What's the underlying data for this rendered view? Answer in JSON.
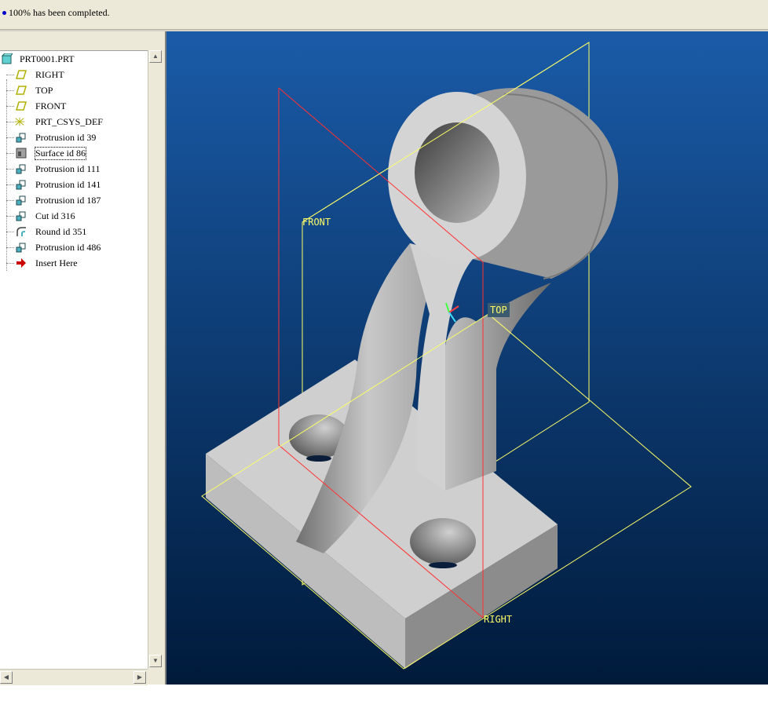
{
  "message_bar": {
    "text": "100% has been completed."
  },
  "model_tree": {
    "root": "PRT0001.PRT",
    "items": [
      {
        "label": "RIGHT",
        "icon": "datum-plane-icon"
      },
      {
        "label": "TOP",
        "icon": "datum-plane-icon"
      },
      {
        "label": "FRONT",
        "icon": "datum-plane-icon"
      },
      {
        "label": "PRT_CSYS_DEF",
        "icon": "coordinate-system-icon"
      },
      {
        "label": "Protrusion id 39",
        "icon": "protrusion-icon"
      },
      {
        "label": "Surface id 86",
        "icon": "surface-icon",
        "selected": true
      },
      {
        "label": "Protrusion id 111",
        "icon": "protrusion-icon"
      },
      {
        "label": "Protrusion id 141",
        "icon": "protrusion-icon"
      },
      {
        "label": "Protrusion id 187",
        "icon": "protrusion-icon"
      },
      {
        "label": "Cut id 316",
        "icon": "cut-icon"
      },
      {
        "label": "Round id 351",
        "icon": "round-icon"
      },
      {
        "label": "Protrusion id 486",
        "icon": "protrusion-icon"
      },
      {
        "label": "Insert Here",
        "icon": "insert-here-arrow-icon"
      }
    ]
  },
  "viewport": {
    "datum_labels": {
      "front": "FRONT",
      "top": "TOP",
      "right": "RIGHT"
    },
    "colors": {
      "background_top": "#1a5ba8",
      "background_bottom": "#001a3a",
      "datum_plane": "#ffff66",
      "selected_plane": "#ff3030",
      "part": "#c8c8c8"
    }
  }
}
